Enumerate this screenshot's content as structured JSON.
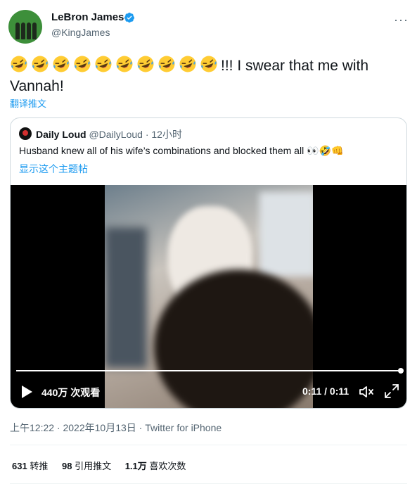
{
  "author": {
    "name": "LeBron James",
    "handle": "@KingJames"
  },
  "tweet": {
    "emoji_count": 10,
    "text": "!!! I swear that me with Vannah!",
    "translate_label": "翻译推文"
  },
  "quote": {
    "name": "Daily Loud",
    "handle": "@DailyLoud",
    "separator": "·",
    "time": "12小时",
    "text": "Husband knew all of his wife’s combinations and blocked them all 👀🤣👊",
    "show_thread": "显示这个主题帖"
  },
  "video": {
    "views": "440万 次观看",
    "time": "0:11 / 0:11",
    "progress": 1.0
  },
  "meta": {
    "timestamp": "上午12:22 · 2022年10月13日",
    "separator": "·",
    "source": "Twitter for iPhone"
  },
  "stats": {
    "retweets": "631",
    "retweets_label": "转推",
    "quotes": "98",
    "quotes_label": "引用推文",
    "likes": "1.1万",
    "likes_label": "喜欢次数"
  },
  "colors": {
    "accent": "#1d9bf0",
    "text": "#0f1419",
    "secondary": "#536471",
    "border": "#cfd9de"
  },
  "icons": [
    "verified-badge-icon",
    "more-icon",
    "laughing-emoji-icon",
    "play-icon",
    "mute-icon",
    "fullscreen-icon"
  ]
}
